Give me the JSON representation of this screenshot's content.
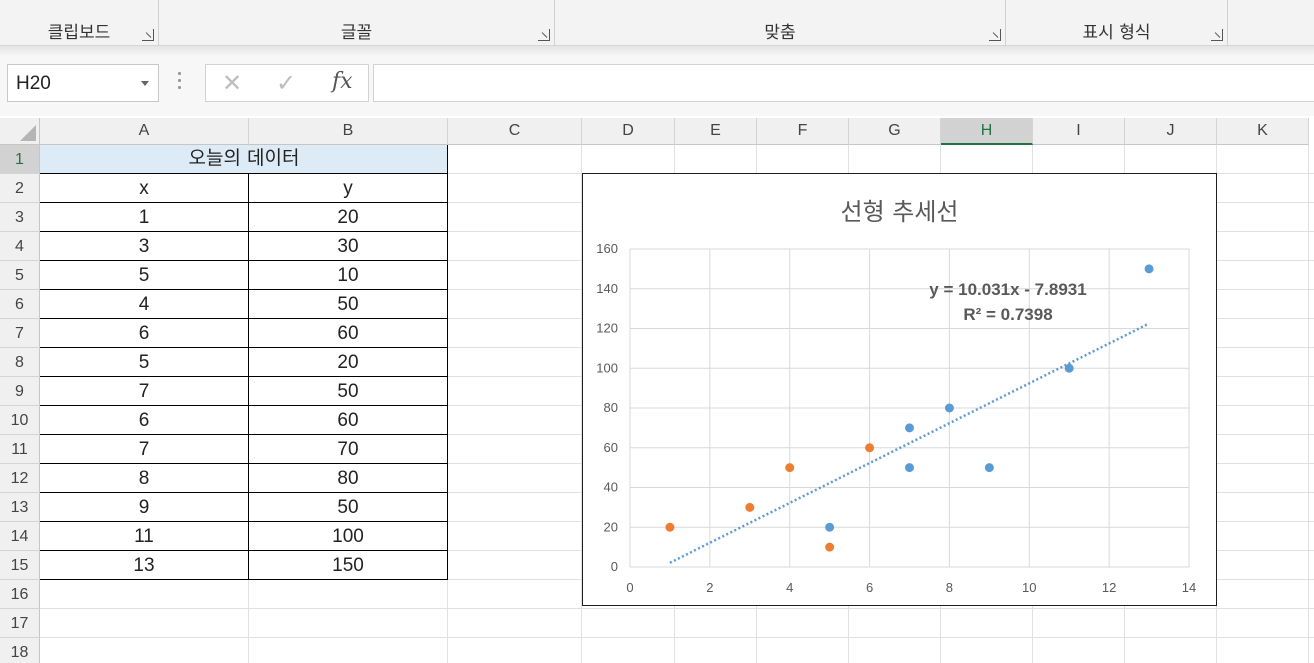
{
  "ribbon": {
    "groups": [
      {
        "label": "클립보드"
      },
      {
        "label": "글꼴"
      },
      {
        "label": "맞춤"
      },
      {
        "label": "표시 형식"
      }
    ]
  },
  "formula_bar": {
    "name_box": "H20",
    "cancel_icon": "✕",
    "enter_icon": "✓",
    "fx_label": "fx",
    "formula": ""
  },
  "columns": [
    "A",
    "B",
    "C",
    "D",
    "E",
    "F",
    "G",
    "H",
    "I",
    "J",
    "K"
  ],
  "selected_column": "H",
  "rows": [
    "1",
    "2",
    "3",
    "4",
    "5",
    "6",
    "7",
    "8",
    "9",
    "10",
    "11",
    "12",
    "13",
    "14",
    "15",
    "16",
    "17",
    "18"
  ],
  "table": {
    "title": "오늘의 데이터",
    "header": {
      "x": "x",
      "y": "y"
    },
    "rows": [
      {
        "x": "1",
        "y": "20"
      },
      {
        "x": "3",
        "y": "30"
      },
      {
        "x": "5",
        "y": "10"
      },
      {
        "x": "4",
        "y": "50"
      },
      {
        "x": "6",
        "y": "60"
      },
      {
        "x": "5",
        "y": "20"
      },
      {
        "x": "7",
        "y": "50"
      },
      {
        "x": "6",
        "y": "60"
      },
      {
        "x": "7",
        "y": "70"
      },
      {
        "x": "8",
        "y": "80"
      },
      {
        "x": "9",
        "y": "50"
      },
      {
        "x": "11",
        "y": "100"
      },
      {
        "x": "13",
        "y": "150"
      }
    ]
  },
  "chart_data": {
    "type": "scatter",
    "title": "선형 추세선",
    "xlabel": "",
    "ylabel": "",
    "xlim": [
      0,
      14
    ],
    "ylim": [
      0,
      160
    ],
    "x_ticks": [
      "0",
      "2",
      "4",
      "6",
      "8",
      "10",
      "12",
      "14"
    ],
    "y_ticks": [
      "0",
      "20",
      "40",
      "60",
      "80",
      "100",
      "120",
      "140",
      "160"
    ],
    "grid": true,
    "series": [
      {
        "color": "#5b9bd5",
        "points": [
          [
            5,
            20
          ],
          [
            7,
            50
          ],
          [
            7,
            70
          ],
          [
            8,
            80
          ],
          [
            9,
            50
          ],
          [
            11,
            100
          ],
          [
            13,
            150
          ]
        ]
      },
      {
        "color": "#ed7d31",
        "points": [
          [
            1,
            20
          ],
          [
            3,
            30
          ],
          [
            4,
            50
          ],
          [
            5,
            10
          ],
          [
            6,
            60
          ]
        ]
      }
    ],
    "trendline": {
      "style": "dotted",
      "color": "#5b9bd5",
      "slope": 10.031,
      "intercept": -7.8931,
      "x_range": [
        1,
        13
      ],
      "equation": "y = 10.031x - 7.8931",
      "r_squared": "R² = 0.7398"
    }
  }
}
